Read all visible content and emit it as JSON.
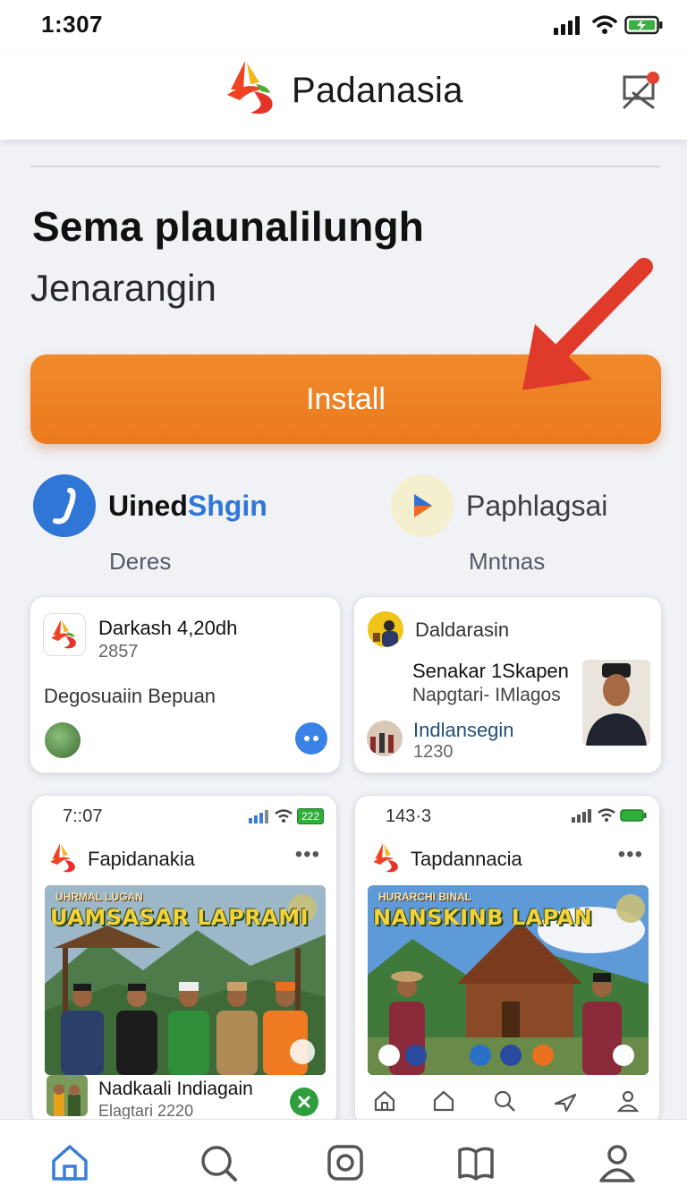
{
  "status_bar": {
    "time": "1:307"
  },
  "header": {
    "app_name": "Padanasia"
  },
  "hero": {
    "title": "Sema plaunalilungh",
    "subtitle": "Jenarangin",
    "install_label": "Install"
  },
  "related_apps": [
    {
      "name_part1": "Uined",
      "name_part2": "Shgin",
      "sub": "Deres"
    },
    {
      "name": "Paphlagsai",
      "sub": "Mntnas"
    }
  ],
  "cards": {
    "left": {
      "title": "Darkash 4,20dh",
      "count": "2857",
      "description": "Degosuaiin Bepuan"
    },
    "right": {
      "header": "Daldarasin",
      "title": "Senakar 1Skapen",
      "subtitle": "Napgtari- IMlagos",
      "link": "Indlansegin",
      "count": "1230"
    }
  },
  "phone_cards": {
    "left": {
      "time": "7::07",
      "battery": "222",
      "app_title": "Fapidanakia",
      "banner_kicker": "UHRMAL LUGAN",
      "banner_title": "UAMSASAR LAPRAMI",
      "footer_title": "Nadkaali Indiagain",
      "footer_sub": "Elagtari 2220"
    },
    "right": {
      "time": "143·3",
      "app_title": "Tapdannacia",
      "banner_kicker": "HURARCHI BINAL",
      "banner_title": "NANSKINB LAPAN"
    }
  },
  "colors": {
    "accent_orange": "#ee7e22",
    "annotation_red": "#e03a2a",
    "link_blue": "#1f4f7a",
    "brand_green": "#4caf2e",
    "nav_active": "#3b7ed8"
  }
}
